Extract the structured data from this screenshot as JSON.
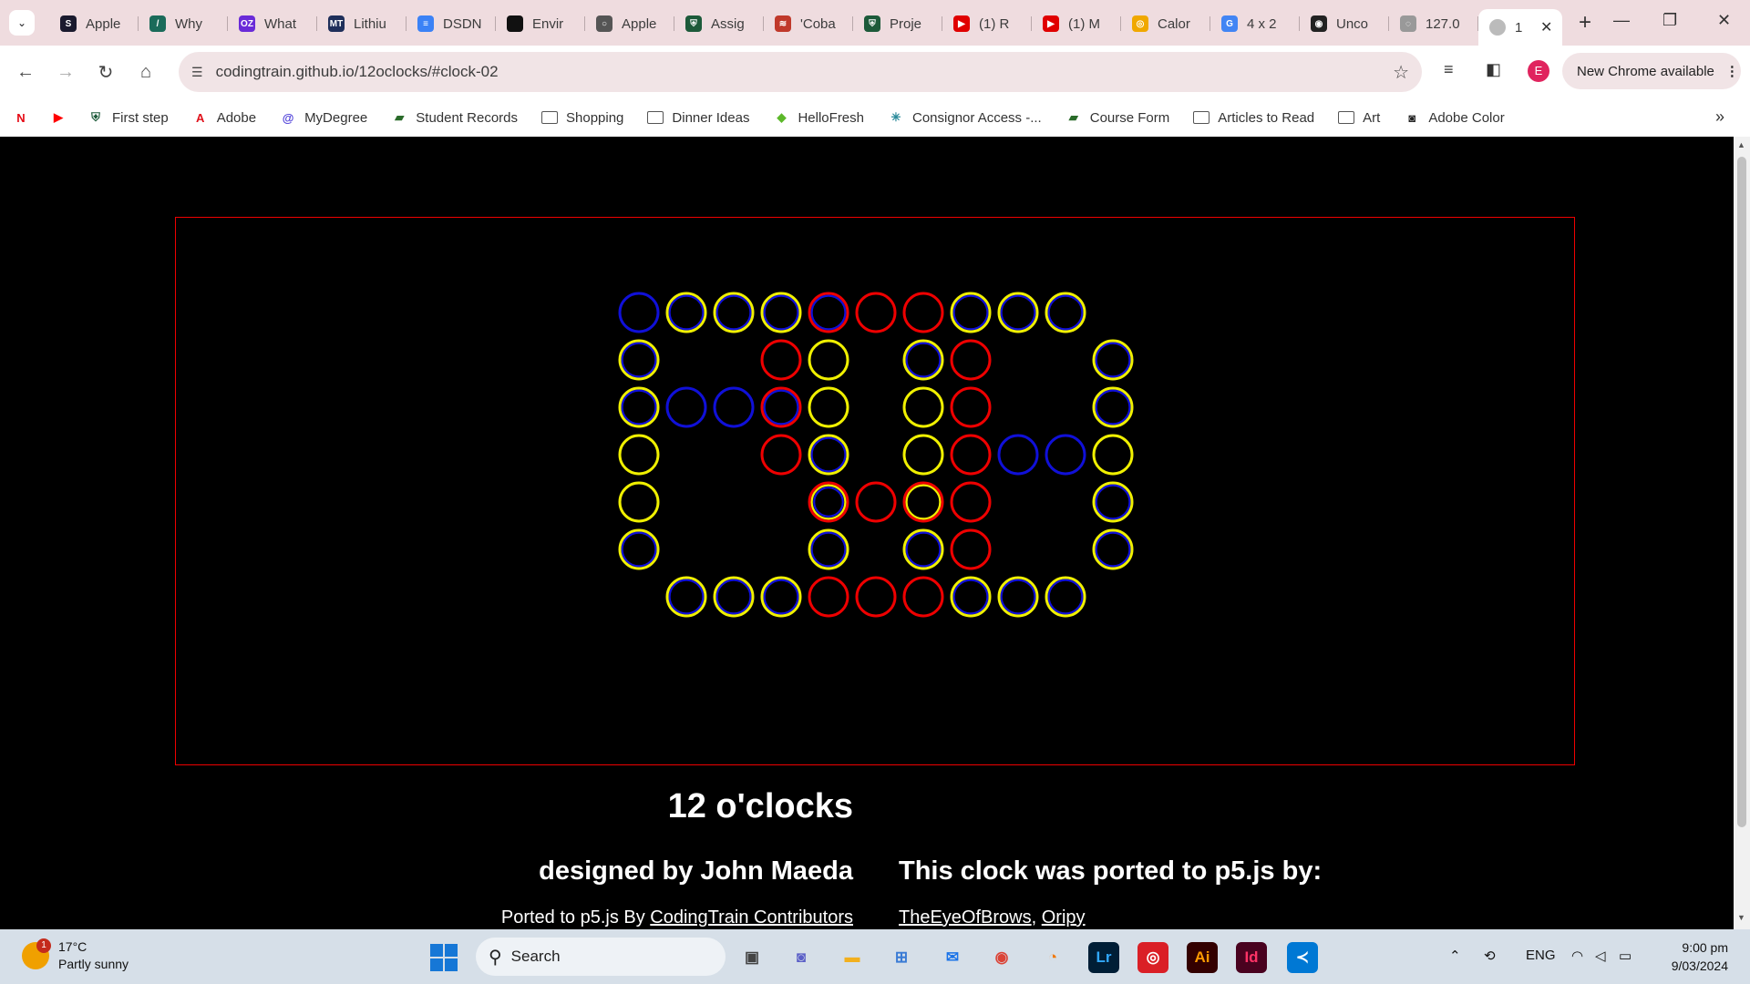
{
  "browser": {
    "tabs": [
      {
        "title": "Apple",
        "favicon_text": "S",
        "favicon_color": "#1a1a2e"
      },
      {
        "title": "Why",
        "favicon_text": "/",
        "favicon_color": "#1b6b5a"
      },
      {
        "title": "What",
        "favicon_text": "OZ",
        "favicon_color": "#6a2bd8"
      },
      {
        "title": "Lithiu",
        "favicon_text": "MT",
        "favicon_color": "#1f2f5a"
      },
      {
        "title": "DSDN",
        "favicon_text": "≡",
        "favicon_color": "#3b82f6"
      },
      {
        "title": "Envir",
        "favicon_text": "",
        "favicon_color": "#111111"
      },
      {
        "title": "Apple",
        "favicon_text": "○",
        "favicon_color": "#555555"
      },
      {
        "title": "Assig",
        "favicon_text": "⛨",
        "favicon_color": "#1d5a3a"
      },
      {
        "title": "'Coba",
        "favicon_text": "≋",
        "favicon_color": "#c0392b"
      },
      {
        "title": "Proje",
        "favicon_text": "⛨",
        "favicon_color": "#1d5a3a"
      },
      {
        "title": "(1) R",
        "favicon_text": "▶",
        "favicon_color": "#e00000"
      },
      {
        "title": "(1) M",
        "favicon_text": "▶",
        "favicon_color": "#e00000"
      },
      {
        "title": "Calor",
        "favicon_text": "◎",
        "favicon_color": "#f0a800"
      },
      {
        "title": "4 x 2",
        "favicon_text": "G",
        "favicon_color": "#4285f4"
      },
      {
        "title": "Unco",
        "favicon_text": "◉",
        "favicon_color": "#222222"
      },
      {
        "title": "127.0",
        "favicon_text": "◌",
        "favicon_color": "#999999"
      }
    ],
    "active_tab": {
      "title": "1",
      "close": "✕"
    },
    "new_tab": "+",
    "window_controls": {
      "minimize": "—",
      "restore": "❐",
      "close": "✕"
    },
    "url": "codingtrain.github.io/12oclocks/#clock-02",
    "update_label": "New Chrome available",
    "profile_initial": "E",
    "bookmarks": [
      {
        "label": "",
        "icon": "N",
        "icon_color": "#e50914"
      },
      {
        "label": "",
        "icon": "▶",
        "icon_color": "#ff0000"
      },
      {
        "label": "First step",
        "icon": "⛨",
        "icon_color": "#1d5a3a"
      },
      {
        "label": "Adobe",
        "icon": "A",
        "icon_color": "#e0101a"
      },
      {
        "label": "MyDegree",
        "icon": "@",
        "icon_color": "#4a3bd8"
      },
      {
        "label": "Student Records",
        "icon": "▰",
        "icon_color": "#2a6b2a"
      },
      {
        "label": "Shopping",
        "icon": "folder",
        "icon_color": "#555555"
      },
      {
        "label": "Dinner Ideas",
        "icon": "folder",
        "icon_color": "#555555"
      },
      {
        "label": "HelloFresh",
        "icon": "◆",
        "icon_color": "#5cb82a"
      },
      {
        "label": "Consignor Access -...",
        "icon": "✳",
        "icon_color": "#2a8a9a"
      },
      {
        "label": "Course Form",
        "icon": "▰",
        "icon_color": "#2a6b2a"
      },
      {
        "label": "Articles to Read",
        "icon": "folder",
        "icon_color": "#555555"
      },
      {
        "label": "Art",
        "icon": "folder",
        "icon_color": "#555555"
      },
      {
        "label": "Adobe Color",
        "icon": "◙",
        "icon_color": "#222222"
      }
    ]
  },
  "page": {
    "title": "12 o'clocks",
    "designer": "designed by John Maeda",
    "ported_heading": "This clock was ported to p5.js by:",
    "ported_prefix": "Ported to p5.js By ",
    "ported_link": "CodingTrain Contributors",
    "porter1": "TheEyeOfBrows",
    "porter_sep": ", ",
    "porter2": "Oripy"
  },
  "clock": {
    "colors": {
      "blue": "#1010d8",
      "yellow": "#f0f000",
      "red": "#ee0000",
      "frame": "#e00000"
    },
    "rings": [
      {
        "col": 0,
        "row": 0,
        "c": [
          "blue"
        ]
      },
      {
        "col": 1,
        "row": 0,
        "c": [
          "yellow",
          "blue"
        ]
      },
      {
        "col": 2,
        "row": 0,
        "c": [
          "yellow",
          "blue"
        ]
      },
      {
        "col": 3,
        "row": 0,
        "c": [
          "yellow",
          "blue"
        ]
      },
      {
        "col": 4,
        "row": 0,
        "c": [
          "red",
          "blue"
        ]
      },
      {
        "col": 5,
        "row": 0,
        "c": [
          "red"
        ]
      },
      {
        "col": 6,
        "row": 0,
        "c": [
          "red"
        ]
      },
      {
        "col": 7,
        "row": 0,
        "c": [
          "yellow",
          "blue"
        ]
      },
      {
        "col": 8,
        "row": 0,
        "c": [
          "yellow",
          "blue"
        ]
      },
      {
        "col": 9,
        "row": 0,
        "c": [
          "yellow",
          "blue"
        ]
      },
      {
        "col": 0,
        "row": 1,
        "c": [
          "yellow",
          "blue"
        ]
      },
      {
        "col": 3,
        "row": 1,
        "c": [
          "red"
        ]
      },
      {
        "col": 4,
        "row": 1,
        "c": [
          "yellow"
        ]
      },
      {
        "col": 6,
        "row": 1,
        "c": [
          "yellow",
          "blue"
        ]
      },
      {
        "col": 7,
        "row": 1,
        "c": [
          "red"
        ]
      },
      {
        "col": 10,
        "row": 1,
        "c": [
          "yellow",
          "blue"
        ]
      },
      {
        "col": 0,
        "row": 2,
        "c": [
          "yellow",
          "blue"
        ]
      },
      {
        "col": 1,
        "row": 2,
        "c": [
          "blue"
        ]
      },
      {
        "col": 2,
        "row": 2,
        "c": [
          "blue"
        ]
      },
      {
        "col": 3,
        "row": 2,
        "c": [
          "red",
          "blue"
        ]
      },
      {
        "col": 4,
        "row": 2,
        "c": [
          "yellow"
        ]
      },
      {
        "col": 6,
        "row": 2,
        "c": [
          "yellow"
        ]
      },
      {
        "col": 7,
        "row": 2,
        "c": [
          "red"
        ]
      },
      {
        "col": 10,
        "row": 2,
        "c": [
          "yellow",
          "blue"
        ]
      },
      {
        "col": 0,
        "row": 3,
        "c": [
          "yellow"
        ]
      },
      {
        "col": 3,
        "row": 3,
        "c": [
          "red"
        ]
      },
      {
        "col": 4,
        "row": 3,
        "c": [
          "yellow",
          "blue"
        ]
      },
      {
        "col": 6,
        "row": 3,
        "c": [
          "yellow"
        ]
      },
      {
        "col": 7,
        "row": 3,
        "c": [
          "red"
        ]
      },
      {
        "col": 8,
        "row": 3,
        "c": [
          "blue"
        ]
      },
      {
        "col": 9,
        "row": 3,
        "c": [
          "blue"
        ]
      },
      {
        "col": 10,
        "row": 3,
        "c": [
          "yellow"
        ]
      },
      {
        "col": 0,
        "row": 4,
        "c": [
          "yellow"
        ]
      },
      {
        "col": 4,
        "row": 4,
        "c": [
          "red",
          "yellow",
          "blue"
        ]
      },
      {
        "col": 5,
        "row": 4,
        "c": [
          "red"
        ]
      },
      {
        "col": 6,
        "row": 4,
        "c": [
          "red",
          "yellow"
        ]
      },
      {
        "col": 7,
        "row": 4,
        "c": [
          "red"
        ]
      },
      {
        "col": 10,
        "row": 4,
        "c": [
          "yellow",
          "blue"
        ]
      },
      {
        "col": 0,
        "row": 5,
        "c": [
          "yellow",
          "blue"
        ]
      },
      {
        "col": 4,
        "row": 5,
        "c": [
          "yellow",
          "blue"
        ]
      },
      {
        "col": 6,
        "row": 5,
        "c": [
          "yellow",
          "blue"
        ]
      },
      {
        "col": 7,
        "row": 5,
        "c": [
          "red"
        ]
      },
      {
        "col": 10,
        "row": 5,
        "c": [
          "yellow",
          "blue"
        ]
      },
      {
        "col": 1,
        "row": 6,
        "c": [
          "yellow",
          "blue"
        ]
      },
      {
        "col": 2,
        "row": 6,
        "c": [
          "yellow",
          "blue"
        ]
      },
      {
        "col": 3,
        "row": 6,
        "c": [
          "yellow",
          "blue"
        ]
      },
      {
        "col": 4,
        "row": 6,
        "c": [
          "red"
        ]
      },
      {
        "col": 5,
        "row": 6,
        "c": [
          "red"
        ]
      },
      {
        "col": 6,
        "row": 6,
        "c": [
          "red"
        ]
      },
      {
        "col": 7,
        "row": 6,
        "c": [
          "yellow",
          "blue"
        ]
      },
      {
        "col": 8,
        "row": 6,
        "c": [
          "yellow",
          "blue"
        ]
      },
      {
        "col": 9,
        "row": 6,
        "c": [
          "yellow",
          "blue"
        ]
      }
    ]
  },
  "taskbar": {
    "temperature": "17°C",
    "condition": "Partly sunny",
    "weather_badge": "1",
    "search_placeholder": "Search",
    "language": "ENG",
    "time": "9:00 pm",
    "date": "9/03/2024",
    "apps": [
      {
        "name": "task-view",
        "glyph": "▣",
        "color": "#444444",
        "bg": "transparent"
      },
      {
        "name": "meet",
        "glyph": "◙",
        "color": "#5b5fc7",
        "bg": "transparent"
      },
      {
        "name": "file-explorer",
        "glyph": "▬",
        "color": "#f2b01e",
        "bg": "transparent"
      },
      {
        "name": "store",
        "glyph": "⊞",
        "color": "#3a7bd5",
        "bg": "transparent"
      },
      {
        "name": "mail",
        "glyph": "✉",
        "color": "#1a73e8",
        "bg": "transparent"
      },
      {
        "name": "chrome",
        "glyph": "◉",
        "color": "#db4437",
        "bg": "transparent"
      },
      {
        "name": "blender",
        "glyph": "◔",
        "color": "#f07800",
        "bg": "transparent"
      },
      {
        "name": "lightroom",
        "glyph": "Lr",
        "color": "#31a8ff",
        "bg": "#001e36"
      },
      {
        "name": "creative-cloud",
        "glyph": "◎",
        "color": "#ffffff",
        "bg": "#da1f26"
      },
      {
        "name": "illustrator",
        "glyph": "Ai",
        "color": "#ff9a00",
        "bg": "#330000"
      },
      {
        "name": "indesign",
        "glyph": "Id",
        "color": "#ff3366",
        "bg": "#49021f"
      },
      {
        "name": "vscode",
        "glyph": "≺",
        "color": "#ffffff",
        "bg": "#0078d4"
      }
    ]
  }
}
